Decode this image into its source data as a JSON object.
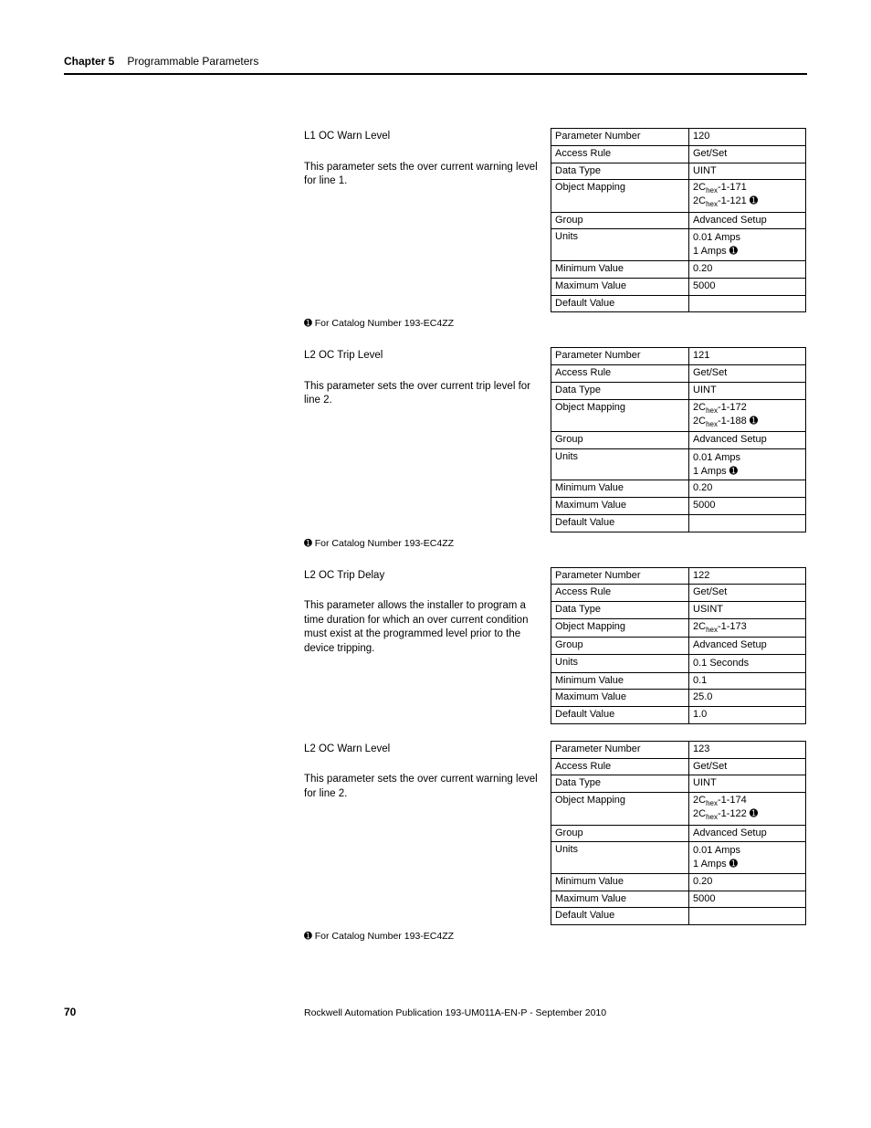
{
  "header": {
    "chapter": "Chapter 5",
    "title": "Programmable Parameters"
  },
  "footnote_text": "For Catalog Number 193-EC4ZZ",
  "footer": {
    "page": "70",
    "publication": "Rockwell Automation Publication 193-UM011A-EN-P - September 2010"
  },
  "labels": {
    "param_number": "Parameter Number",
    "access_rule": "Access Rule",
    "data_type": "Data Type",
    "object_mapping": "Object Mapping",
    "group": "Group",
    "units": "Units",
    "min": "Minimum Value",
    "max": "Maximum Value",
    "default": "Default Value"
  },
  "params": [
    {
      "name": "L1 OC Warn Level",
      "desc": "This parameter sets the over current warning level for line 1.",
      "number": "120",
      "access": "Get/Set",
      "dtype": "UINT",
      "mapping1": "-1-171",
      "mapping2": "-1-121",
      "mapping2_has_note": true,
      "group": "Advanced Setup",
      "units1": "0.01 Amps",
      "units2": "1 Amps",
      "units2_has_note": true,
      "min": "0.20",
      "max": "5000",
      "default": "",
      "has_footnote": true
    },
    {
      "name": "L2 OC Trip Level",
      "desc": "This parameter sets the over current trip level for line 2.",
      "number": "121",
      "access": "Get/Set",
      "dtype": "UINT",
      "mapping1": "-1-172",
      "mapping2": "-1-188",
      "mapping2_has_note": true,
      "group": "Advanced Setup",
      "units1": "0.01 Amps",
      "units2": "1 Amps",
      "units2_has_note": true,
      "min": "0.20",
      "max": "5000",
      "default": "",
      "has_footnote": true
    },
    {
      "name": "L2 OC Trip Delay",
      "desc": "This parameter allows the installer to program a time duration for which an over current condition must exist at the programmed level prior to the device tripping.",
      "number": "122",
      "access": "Get/Set",
      "dtype": "USINT",
      "mapping1": "-1-173",
      "mapping2": null,
      "mapping2_has_note": false,
      "group": "Advanced Setup",
      "units1": "0.1 Seconds",
      "units2": null,
      "units2_has_note": false,
      "min": "0.1",
      "max": "25.0",
      "default": "1.0",
      "has_footnote": false
    },
    {
      "name": "L2 OC Warn Level",
      "desc": "This parameter sets the over current warning level for line 2.",
      "number": "123",
      "access": "Get/Set",
      "dtype": "UINT",
      "mapping1": "-1-174",
      "mapping2": "-1-122",
      "mapping2_has_note": true,
      "group": "Advanced Setup",
      "units1": "0.01 Amps",
      "units2": "1 Amps",
      "units2_has_note": true,
      "min": "0.20",
      "max": "5000",
      "default": "",
      "has_footnote": true
    }
  ]
}
